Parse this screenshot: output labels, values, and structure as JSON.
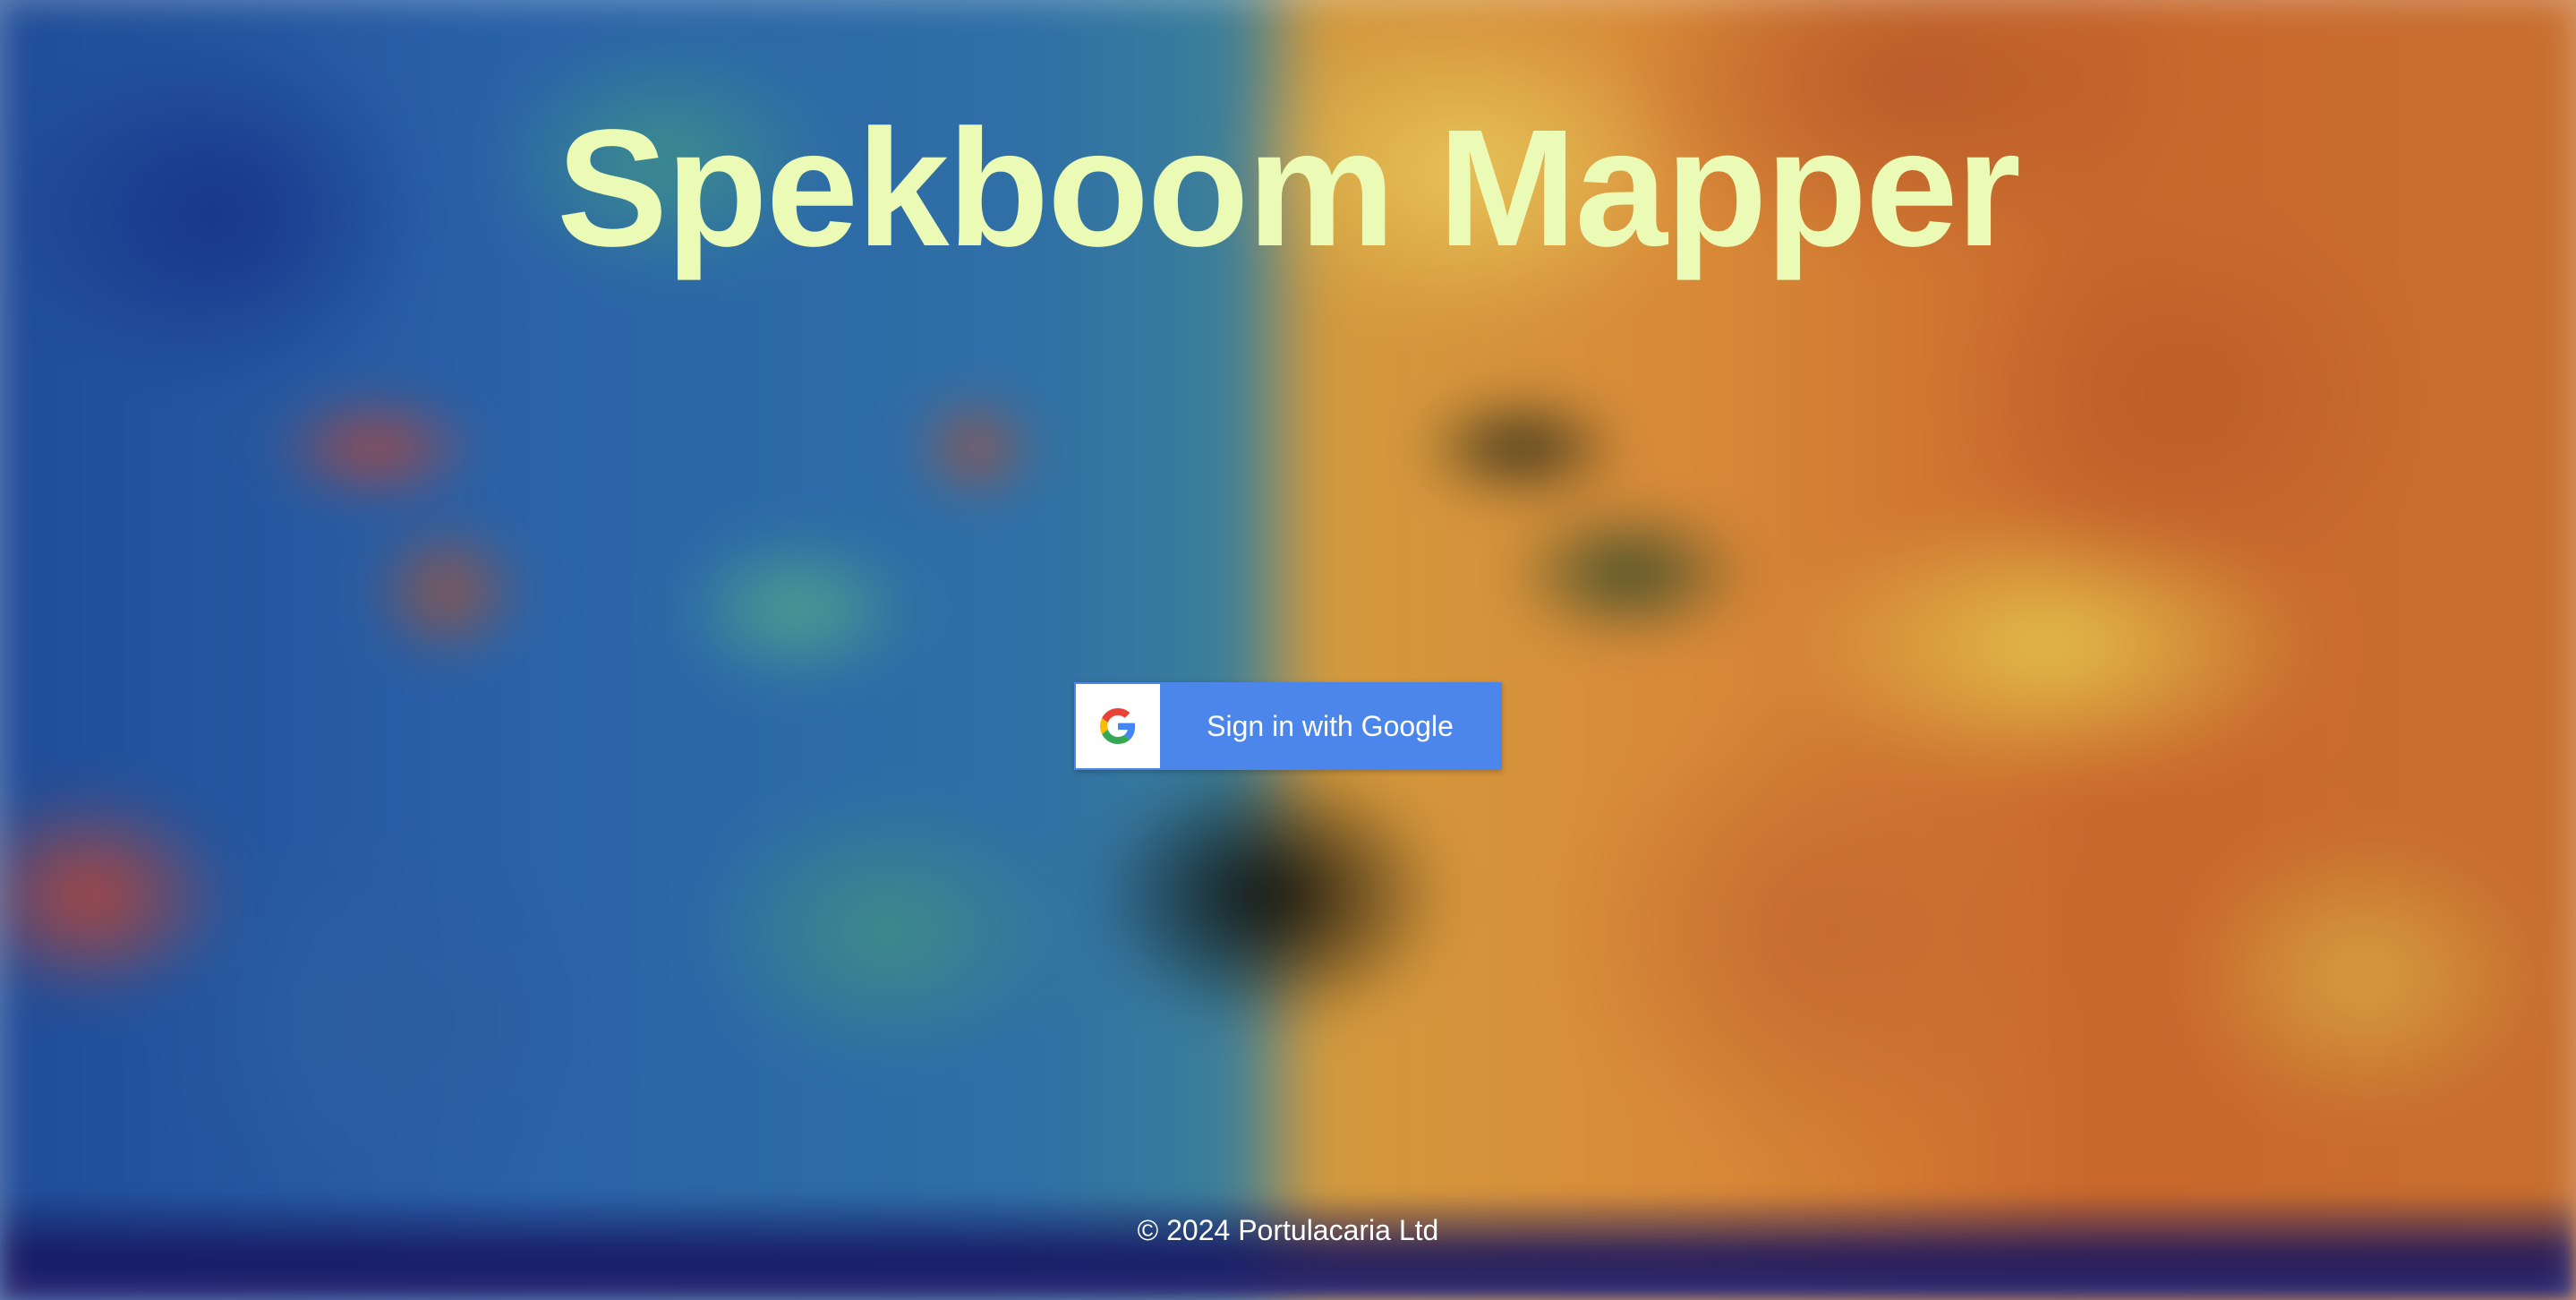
{
  "app": {
    "title": "Spekboom Mapper"
  },
  "signin": {
    "label": "Sign in with Google",
    "icon": "google-g-icon",
    "button_color": "#4d86ea"
  },
  "footer": {
    "copyright": "© 2024 Portulacaria Ltd"
  },
  "colors": {
    "title": "#ebfbb5",
    "footer_text": "#ffffff"
  }
}
